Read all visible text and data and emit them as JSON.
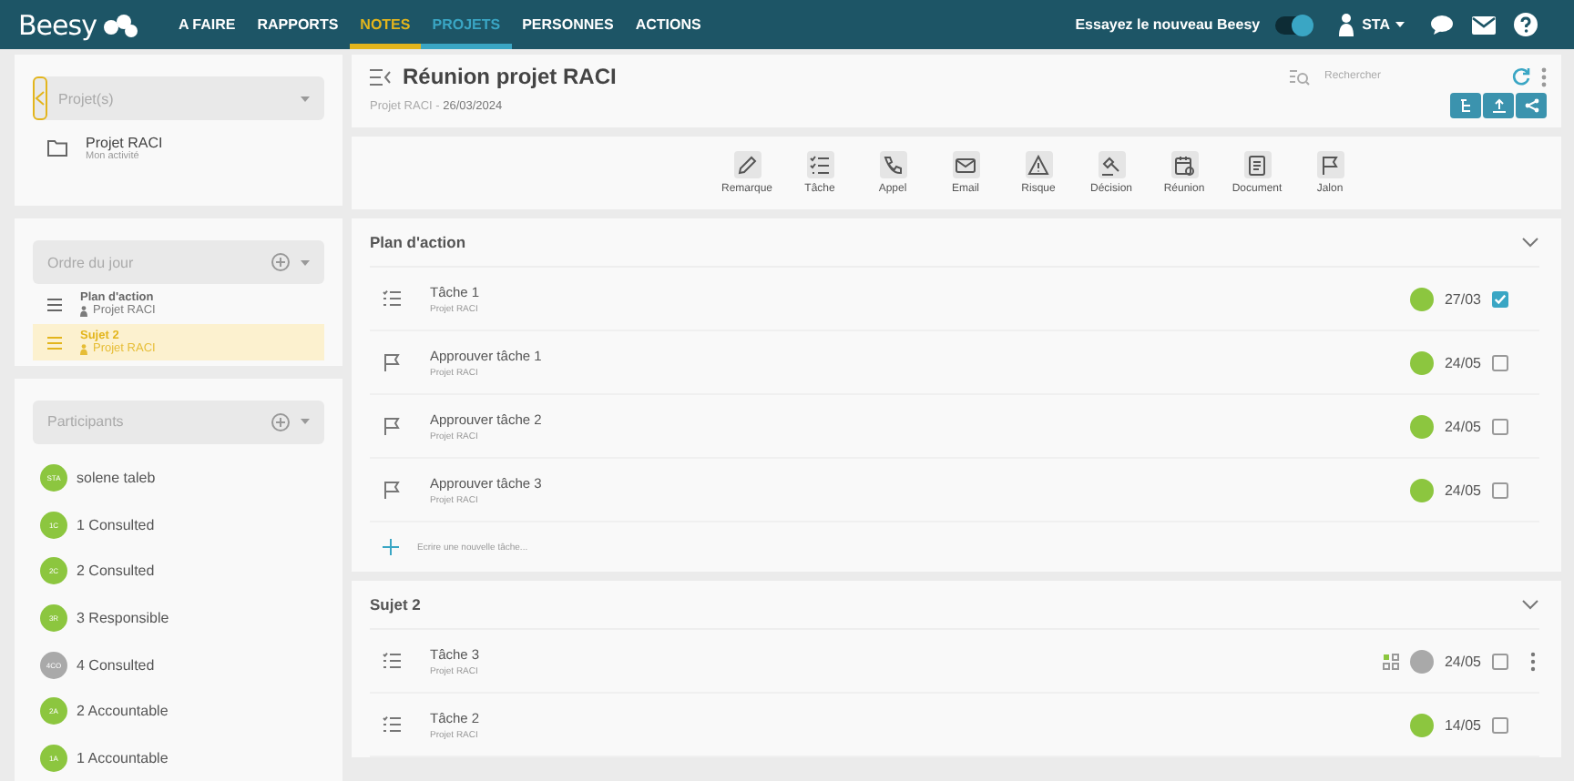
{
  "nav": {
    "logo": "Beesy",
    "items": [
      {
        "label": "A FAIRE",
        "selected": false
      },
      {
        "label": "RAPPORTS",
        "selected": false
      },
      {
        "label": "NOTES",
        "selected": true,
        "color": "#e3b51c"
      },
      {
        "label": "PROJETS",
        "selected": true,
        "color": "#3aa6c4"
      },
      {
        "label": "PERSONNES",
        "selected": false
      },
      {
        "label": "ACTIONS",
        "selected": false
      }
    ],
    "toggle": {
      "label": "Essayez le nouveau Beesy",
      "on": true
    },
    "user": "STA"
  },
  "projects": {
    "placeholder": "Projet(s)",
    "items": [
      {
        "name": "Projet RACI",
        "subtitle": "Mon activité"
      }
    ]
  },
  "agenda": {
    "placeholder": "Ordre du jour",
    "items": [
      {
        "title": "Plan d'action",
        "project": "Projet RACI",
        "selected": false
      },
      {
        "title": "Sujet 2",
        "project": "Projet RACI",
        "selected": true
      }
    ]
  },
  "participants": {
    "placeholder": "Participants",
    "items": [
      {
        "initials": "STA",
        "name": "solene taleb",
        "color": "#8cc63f"
      },
      {
        "initials": "1C",
        "name": "1 Consulted",
        "color": "#8cc63f"
      },
      {
        "initials": "2C",
        "name": "2 Consulted",
        "color": "#8cc63f"
      },
      {
        "initials": "3R",
        "name": "3 Responsible",
        "color": "#8cc63f"
      },
      {
        "initials": "4CO",
        "name": "4 Consulted",
        "color": "#a9a9a9"
      },
      {
        "initials": "2A",
        "name": "2 Accountable",
        "color": "#8cc63f"
      },
      {
        "initials": "1A",
        "name": "1 Accountable",
        "color": "#8cc63f"
      }
    ]
  },
  "meeting": {
    "title": "Réunion projet RACI",
    "subtitle": "Projet RACI - **26/03/2024**",
    "search_placeholder": "Rechercher"
  },
  "toolbar": [
    {
      "kind": "note",
      "label": "Remarque"
    },
    {
      "kind": "task",
      "label": "Tâche"
    },
    {
      "kind": "call",
      "label": "Appel"
    },
    {
      "kind": "email",
      "label": "Email"
    },
    {
      "kind": "risk",
      "label": "Risque"
    },
    {
      "kind": "decision",
      "label": "Décision"
    },
    {
      "kind": "meeting",
      "label": "Réunion"
    },
    {
      "kind": "document",
      "label": "Document"
    },
    {
      "kind": "milestone",
      "label": "Jalon"
    }
  ],
  "sections": [
    {
      "title": "Plan d'action",
      "expanded": true,
      "new_task_placeholder": "Ecrire une nouvelle tâche...",
      "tasks": [
        {
          "kind": "task",
          "title": "Tâche 1",
          "project": "Projet RACI",
          "date": "27/03",
          "checked": true,
          "color": "#8cc63f"
        },
        {
          "kind": "milestone",
          "title": "Approuver tâche 1",
          "project": "Projet RACI",
          "date": "24/05",
          "checked": false,
          "color": "#8cc63f"
        },
        {
          "kind": "milestone",
          "title": "Approuver tâche 2",
          "project": "Projet RACI",
          "date": "24/05",
          "checked": false,
          "color": "#8cc63f"
        },
        {
          "kind": "milestone",
          "title": "Approuver tâche 3",
          "project": "Projet RACI",
          "date": "24/05",
          "checked": false,
          "color": "#8cc63f"
        }
      ]
    },
    {
      "title": "Sujet 2",
      "expanded": true,
      "tasks": [
        {
          "kind": "task",
          "title": "Tâche 3",
          "project": "Projet RACI",
          "date": "24/05",
          "checked": false,
          "color": "#a9a9a9",
          "hovered": true
        },
        {
          "kind": "task",
          "title": "Tâche 2",
          "project": "Projet RACI",
          "date": "14/05",
          "checked": false,
          "color": "#8cc63f"
        }
      ]
    }
  ]
}
